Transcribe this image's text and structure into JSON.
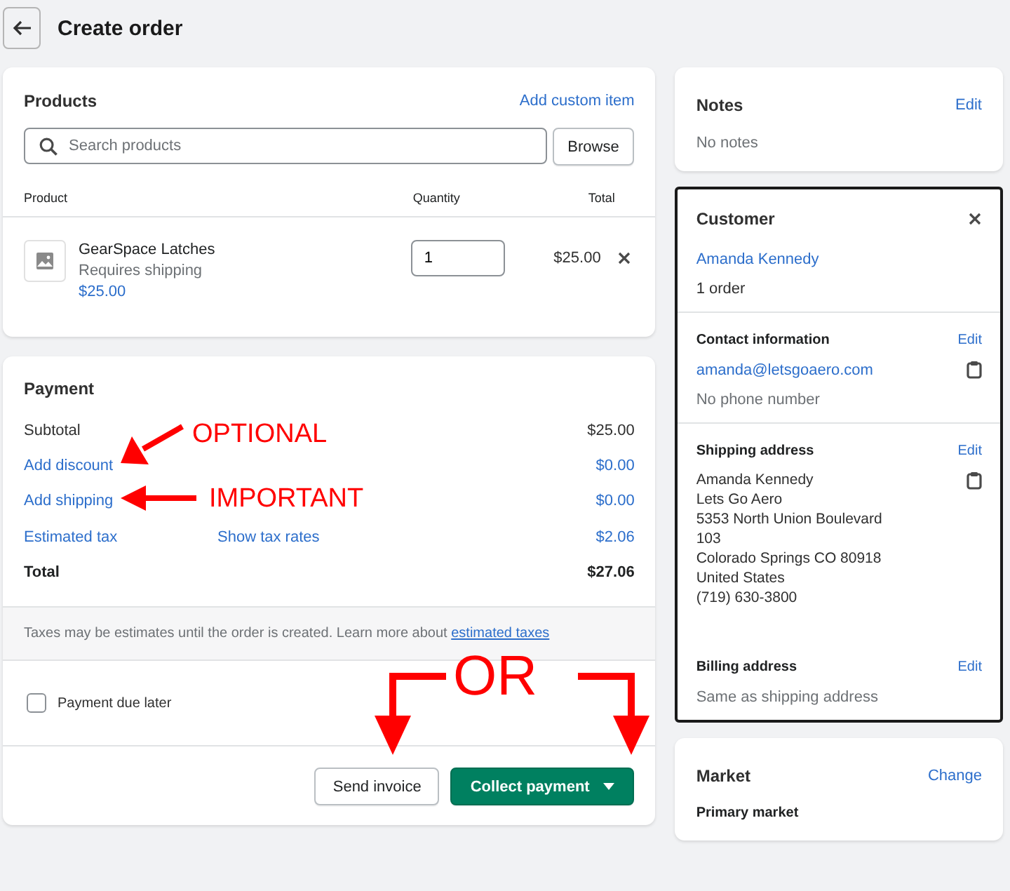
{
  "header": {
    "title": "Create order"
  },
  "products": {
    "title": "Products",
    "action": "Add custom item",
    "search": {
      "placeholder": "Search products"
    },
    "browse": "Browse",
    "columns": [
      "Product",
      "Quantity",
      "Total"
    ],
    "items": [
      {
        "name": "GearSpace Latches",
        "note": "Requires shipping",
        "price": "$25.00",
        "quantity": "1",
        "total": "$25.00"
      }
    ]
  },
  "payment": {
    "title": "Payment",
    "rows": [
      {
        "kind": "plain",
        "label": "Subtotal",
        "amount": "$25.00"
      },
      {
        "kind": "link",
        "label": "Add discount",
        "amount": "$0.00"
      },
      {
        "kind": "link",
        "label": "Add shipping",
        "amount": "$0.00"
      },
      {
        "kind": "link",
        "label": "Estimated tax",
        "middle": "Show tax rates",
        "amount": "$2.06"
      },
      {
        "kind": "total",
        "label": "Total",
        "amount": "$27.06"
      }
    ],
    "notice": "Taxes may be estimates until the order is created. Learn more about",
    "notice_link": "estimated taxes",
    "due_later": {
      "label": "Payment due later",
      "checked": false
    },
    "buttons": [
      {
        "kind": "secondary",
        "label": "Send invoice"
      },
      {
        "kind": "primary",
        "label": "Collect payment"
      }
    ]
  },
  "notes": {
    "title": "Notes",
    "action": "Edit",
    "text": "No notes"
  },
  "customer": {
    "title": "Customer",
    "name": "Amanda Kennedy",
    "orders": "1 order",
    "contact": {
      "title": "Contact information",
      "action": "Edit",
      "email": "amanda@letsgoaero.com",
      "phone": "No phone number"
    },
    "shipping": {
      "title": "Shipping address",
      "action": "Edit",
      "lines": [
        "Amanda Kennedy",
        "Lets Go Aero",
        "5353 North Union Boulevard",
        "103",
        "Colorado Springs CO 80918",
        "United States",
        "(719) 630-3800"
      ]
    },
    "billing": {
      "title": "Billing address",
      "action": "Edit",
      "text": "Same as shipping address"
    }
  },
  "market": {
    "title": "Market",
    "action": "Change",
    "label": "Primary market"
  },
  "annotations": [
    {
      "kind": "arrow-diagonal",
      "text": "OPTIONAL"
    },
    {
      "kind": "arrow-left",
      "text": "IMPORTANT"
    },
    {
      "kind": "fork",
      "text": "OR"
    }
  ]
}
